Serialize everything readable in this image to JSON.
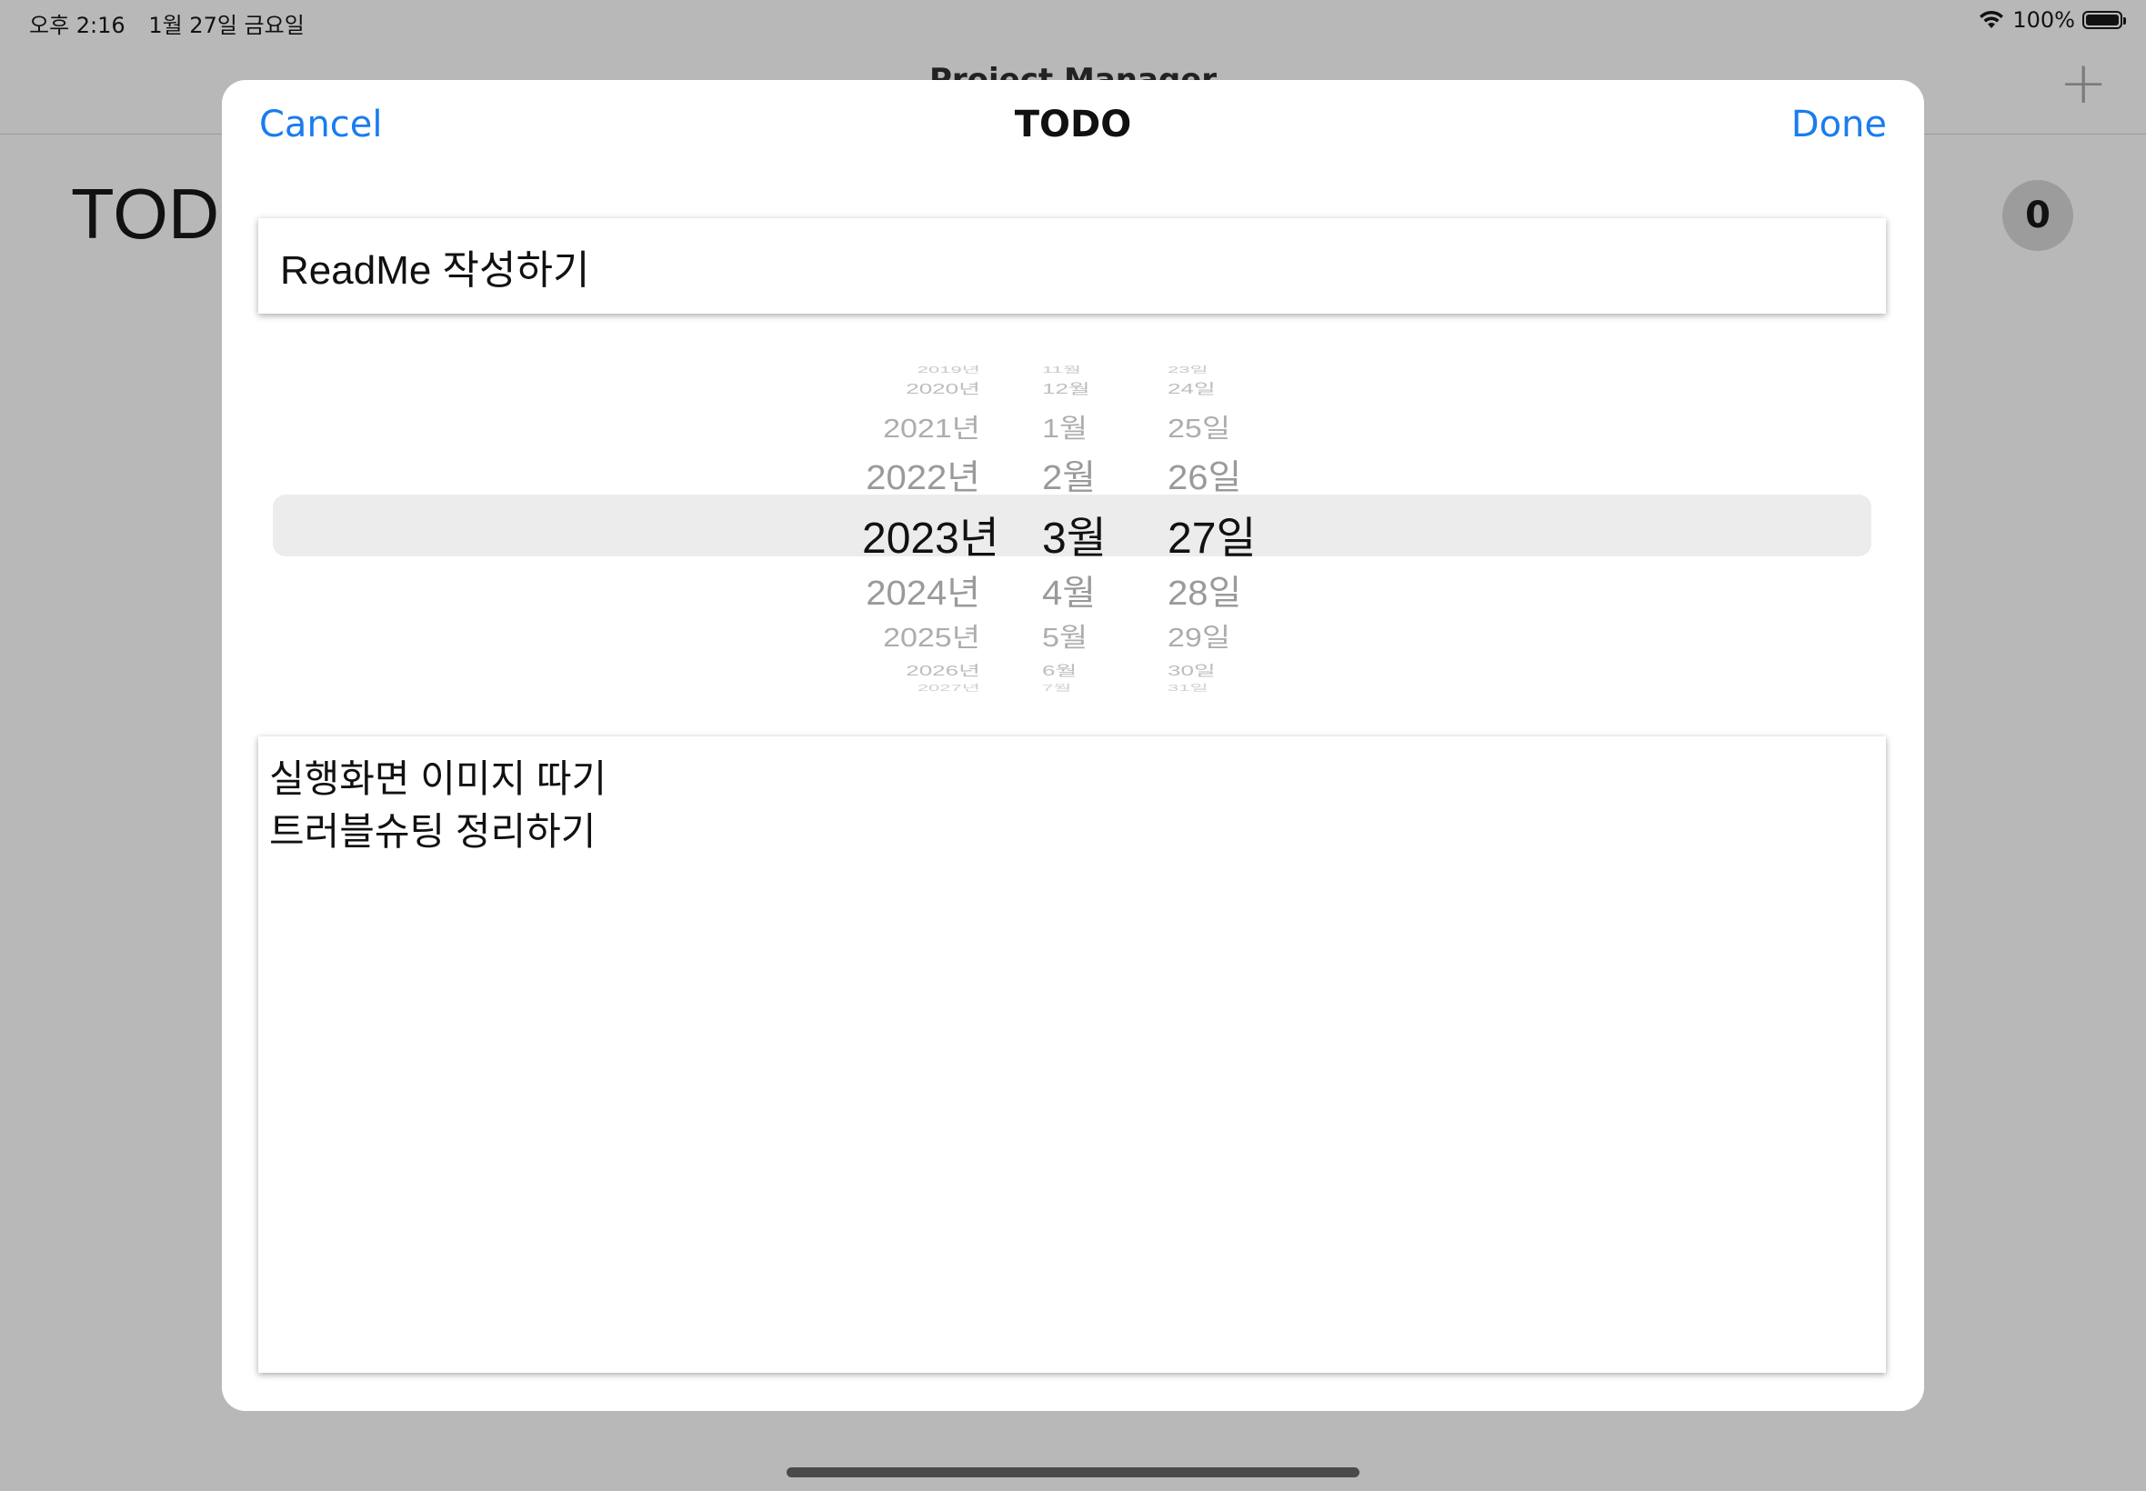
{
  "status_bar": {
    "time": "오후 2:16",
    "date": "1월 27일 금요일",
    "battery": "100%",
    "wifi_icon": "wifi-icon",
    "battery_icon": "battery-icon"
  },
  "background": {
    "nav_title": "Project Manager",
    "add_icon": "plus-icon",
    "add_label": "+",
    "section_title": "TODO",
    "count": "0"
  },
  "modal": {
    "cancel_label": "Cancel",
    "title": "TODO",
    "done_label": "Done",
    "title_field_value": "ReadMe 작성하기",
    "picker": {
      "years": [
        "2019년",
        "2020년",
        "2021년",
        "2022년",
        "2023년",
        "2024년",
        "2025년",
        "2026년",
        "2027년"
      ],
      "months": [
        "11월",
        "12월",
        "1월",
        "2월",
        "3월",
        "4월",
        "5월",
        "6월",
        "7월"
      ],
      "days": [
        "23일",
        "24일",
        "25일",
        "26일",
        "27일",
        "28일",
        "29일",
        "30일",
        "31일"
      ],
      "selected": {
        "year": "2023년",
        "month": "3월",
        "day": "27일"
      }
    },
    "body_lines": [
      "실행화면 이미지 따기",
      "트러블슈팅 정리하기"
    ]
  }
}
